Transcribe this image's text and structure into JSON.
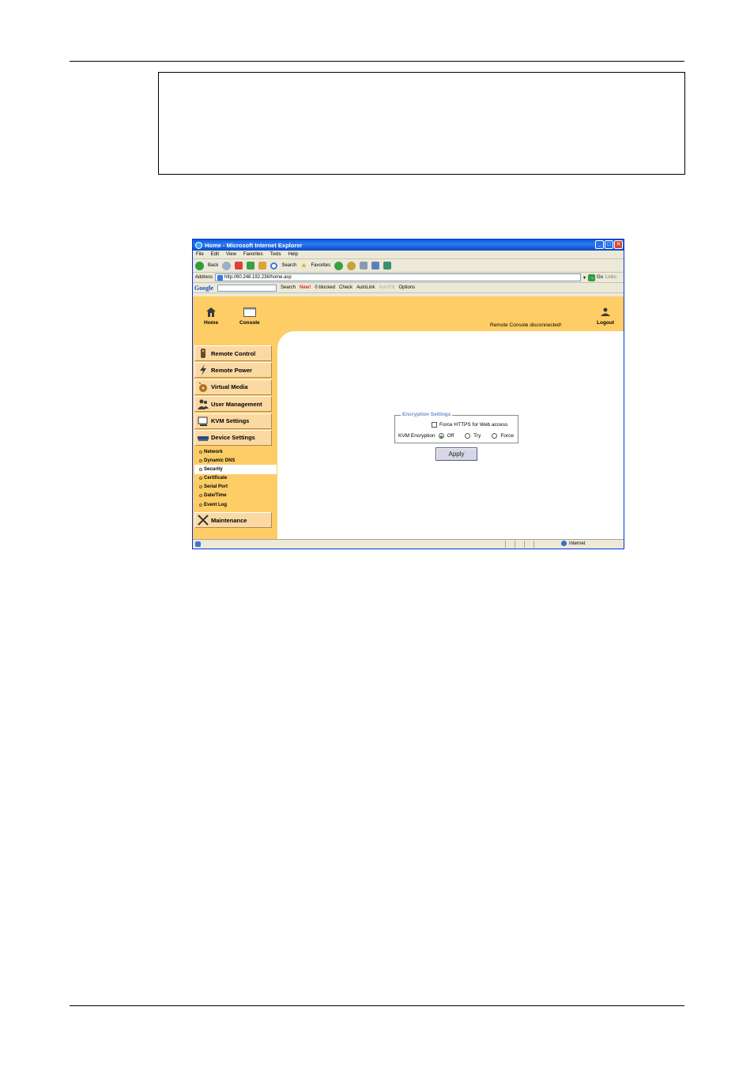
{
  "window": {
    "title": "Home - Microsoft Internet Explorer",
    "buttons": [
      "_",
      "□",
      "✕"
    ]
  },
  "menu": [
    "File",
    "Edit",
    "View",
    "Favorites",
    "Tools",
    "Help"
  ],
  "toolbar": {
    "back": "Back",
    "search": "Search",
    "favorites": "Favorites"
  },
  "address": {
    "label": "Address",
    "url": "http://60.248.192.236/home.asp",
    "go": "Go",
    "links": "Links"
  },
  "google_bar": {
    "logo": "Google",
    "search": "Search",
    "new_badge": "New!",
    "blocked": "0 blocked",
    "check": "Check",
    "autolink": "AutoLink",
    "autofill": "AutoFill",
    "options": "Options"
  },
  "header": {
    "home": "Home",
    "console": "Console",
    "status": "Remote Console disconnected!",
    "logout": "Logout"
  },
  "sidebar": {
    "remote_control": "Remote Control",
    "remote_power": "Remote Power",
    "virtual_media": "Virtual Media",
    "user_management": "User Management",
    "kvm_settings": "KVM Settings",
    "device_settings": "Device Settings",
    "maintenance": "Maintenance",
    "sub_items": [
      "Network",
      "Dynamic DNS",
      "Security",
      "Certificate",
      "Serial Port",
      "Date/Time",
      "Event Log"
    ]
  },
  "encryption": {
    "legend": "Encryption Settings",
    "force_https": "Force HTTPS for Web access",
    "kvm_label": "KVM Encryption",
    "opt_off": "Off",
    "opt_try": "Try",
    "opt_force": "Force",
    "selected": "Off",
    "apply": "Apply"
  },
  "statusbar": {
    "zone": "Internet"
  },
  "colors": {
    "page_bg": "#fecd66",
    "sidebar_button": "#fbd9a3",
    "legend": "#6d8fd0"
  }
}
